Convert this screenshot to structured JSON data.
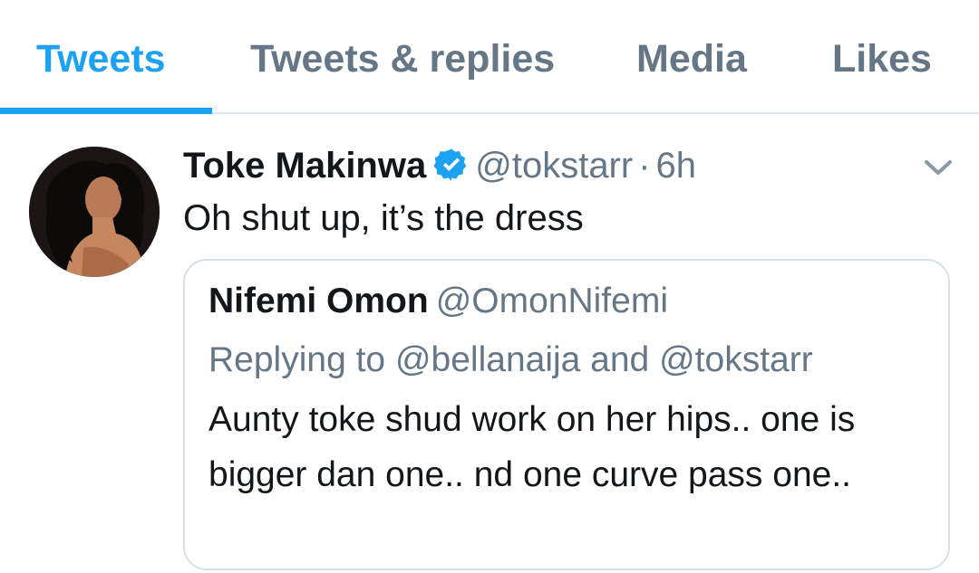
{
  "tabs": [
    {
      "label": "Tweets",
      "active": true
    },
    {
      "label": "Tweets & replies",
      "active": false
    },
    {
      "label": "Media",
      "active": false
    },
    {
      "label": "Likes",
      "active": false
    }
  ],
  "colors": {
    "accent": "#1da1f2",
    "secondary_text": "#657786",
    "primary_text": "#14171a",
    "border": "#e1e8ed"
  },
  "tweet": {
    "author_name": "Toke Makinwa",
    "verified": true,
    "handle": "@tokstarr",
    "separator": "·",
    "time": "6h",
    "text": "Oh shut up, it’s the dress",
    "avatar_icon": "profile-photo",
    "menu_icon": "chevron-down-icon"
  },
  "quote": {
    "author_name": "Nifemi Omon",
    "handle": "@OmonNifemi",
    "replying_to": "Replying to @bellanaija and @tokstarr",
    "text": "Aunty toke shud work on her hips.. one is bigger dan one.. nd one curve pass one.."
  }
}
